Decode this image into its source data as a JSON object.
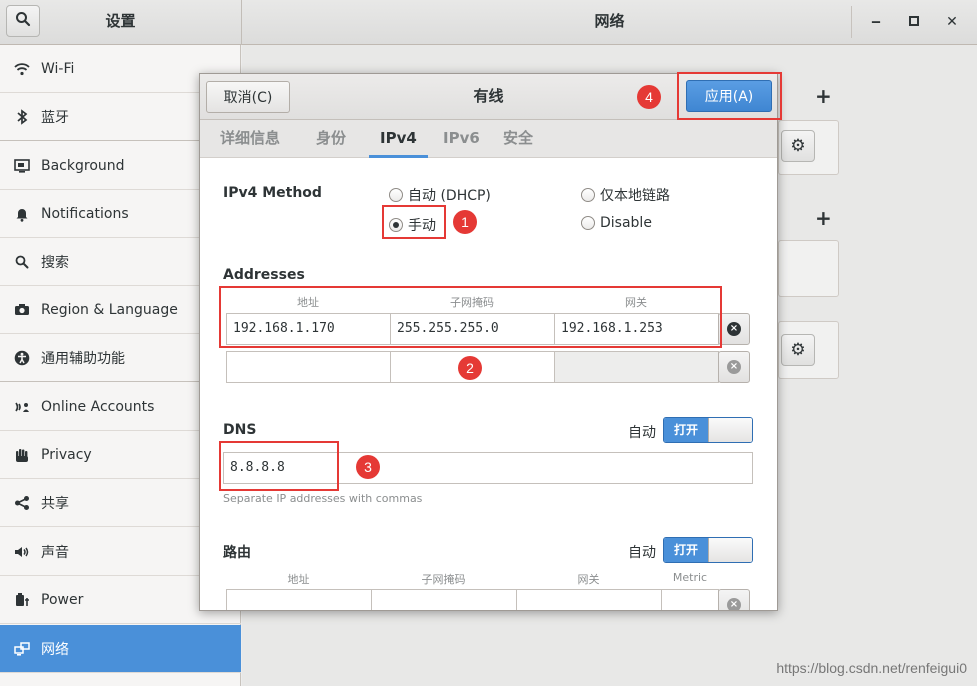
{
  "window": {
    "left_title": "设置",
    "right_title": "网络",
    "minimize_glyph": "‒",
    "maximize_glyph": "▫",
    "close_glyph": "✕"
  },
  "sidebar": {
    "items": [
      {
        "label": "Wi-Fi",
        "icon": "wifi-icon"
      },
      {
        "label": "蓝牙",
        "icon": "bluetooth-icon"
      },
      {
        "label": "Background",
        "icon": "background-icon"
      },
      {
        "label": "Notifications",
        "icon": "bell-icon"
      },
      {
        "label": "搜索",
        "icon": "search-icon"
      },
      {
        "label": "Region & Language",
        "icon": "camera-icon"
      },
      {
        "label": "通用辅助功能",
        "icon": "accessibility-icon"
      },
      {
        "label": "Online Accounts",
        "icon": "online-accounts-icon"
      },
      {
        "label": "Privacy",
        "icon": "hand-icon"
      },
      {
        "label": "共享",
        "icon": "share-icon"
      },
      {
        "label": "声音",
        "icon": "speaker-icon"
      },
      {
        "label": "Power",
        "icon": "power-icon"
      },
      {
        "label": "网络",
        "icon": "network-icon",
        "active": true
      }
    ]
  },
  "main": {
    "plus_glyph": "+",
    "gear_glyph": "⚙"
  },
  "dialog": {
    "cancel_label": "取消(C)",
    "title": "有线",
    "apply_label": "应用(A)",
    "tabs": [
      "详细信息",
      "身份",
      "IPv4",
      "IPv6",
      "安全"
    ],
    "active_tab": "IPv4",
    "ipv4": {
      "method_label": "IPv4 Method",
      "options": {
        "dhcp": "自动 (DHCP)",
        "link_local": "仅本地链路",
        "manual": "手动",
        "disable": "Disable"
      },
      "selected": "manual",
      "addresses_label": "Addresses",
      "columns": [
        "地址",
        "子网掩码",
        "网关"
      ],
      "rows": [
        [
          "192.168.1.170",
          "255.255.255.0",
          "192.168.1.253"
        ],
        [
          "",
          "",
          ""
        ]
      ],
      "dns_label": "DNS",
      "auto_label": "自动",
      "toggle_on_label": "打开",
      "dns_value": "8.8.8.8",
      "dns_hint": "Separate IP addresses with commas",
      "routes_label": "路由",
      "route_columns": [
        "地址",
        "子网掩码",
        "网关",
        "Metric"
      ]
    }
  },
  "annotations": [
    "1",
    "2",
    "3",
    "4"
  ],
  "watermark": "https://blog.csdn.net/renfeigui0",
  "colors": {
    "accent": "#4a90d9",
    "annotation_red": "#e53935"
  }
}
